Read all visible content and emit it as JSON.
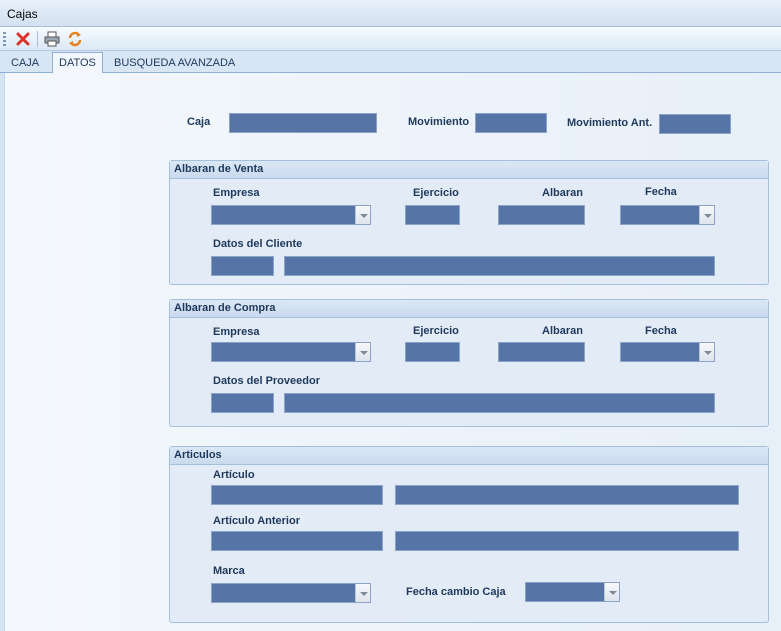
{
  "window": {
    "title": "Cajas"
  },
  "toolbar": {
    "buttons": [
      {
        "icon": "delete-icon"
      },
      {
        "icon": "print-icon"
      },
      {
        "icon": "refresh-icon"
      }
    ]
  },
  "tabs": [
    {
      "label": "CAJA",
      "active": false
    },
    {
      "label": "DATOS",
      "active": true
    },
    {
      "label": "BUSQUEDA AVANZADA",
      "active": false
    }
  ],
  "top": {
    "caja": "Caja",
    "movimiento": "Movimiento",
    "movimiento_ant": "Movimiento Ant."
  },
  "venta": {
    "title": "Albaran de Venta",
    "empresa": "Empresa",
    "ejercicio": "Ejercicio",
    "albaran": "Albaran",
    "fecha": "Fecha",
    "datos": "Datos del Cliente"
  },
  "compra": {
    "title": "Albaran de Compra",
    "empresa": "Empresa",
    "ejercicio": "Ejercicio",
    "albaran": "Albaran",
    "fecha": "Fecha",
    "datos": "Datos del Proveedor"
  },
  "articulos": {
    "title": "Articulos",
    "articulo": "Artículo",
    "articulo_anterior": "Artículo Anterior",
    "marca": "Marca",
    "fecha_cambio": "Fecha cambio Caja"
  },
  "colors": {
    "field": "#5674a6",
    "header": "#c9dbee"
  }
}
